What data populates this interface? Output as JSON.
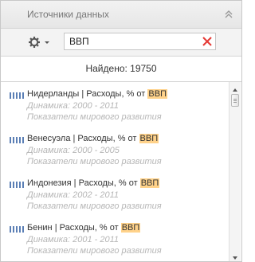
{
  "header": {
    "title": "Источники данных",
    "collapse_icon": "double-chevron-up-icon"
  },
  "toolbar": {
    "settings_icon": "gear-icon",
    "dropdown_icon": "caret-down-icon",
    "search": {
      "value": "ВВП",
      "clear_icon": "red-x-icon"
    }
  },
  "results": {
    "found_label": "Найдено: 19750",
    "items": [
      {
        "country": "Нидерланды",
        "separator": " | ",
        "indicator_prefix": "Расходы, % от ",
        "highlight": "ВВП",
        "dynamics": "Динамика: 2000 - 2011",
        "source": "Показатели мирового развития"
      },
      {
        "country": "Венесуэла",
        "separator": " | ",
        "indicator_prefix": "Расходы, % от ",
        "highlight": "ВВП",
        "dynamics": "Динамика: 2000 - 2005",
        "source": "Показатели мирового развития"
      },
      {
        "country": "Индонезия",
        "separator": " | ",
        "indicator_prefix": "Расходы, % от ",
        "highlight": "ВВП",
        "dynamics": "Динамика: 2002 - 2011",
        "source": "Показатели мирового развития"
      },
      {
        "country": "Бенин",
        "separator": " | ",
        "indicator_prefix": "Расходы, % от ",
        "highlight": "ВВП",
        "dynamics": "Динамика: 2001 - 2011",
        "source": "Показатели мирового развития"
      }
    ]
  },
  "colors": {
    "highlight": "#ffd28a",
    "clear_icon": "#e53935",
    "series_icon": "#5b7fb5",
    "muted_text": "#b6b6b6"
  }
}
